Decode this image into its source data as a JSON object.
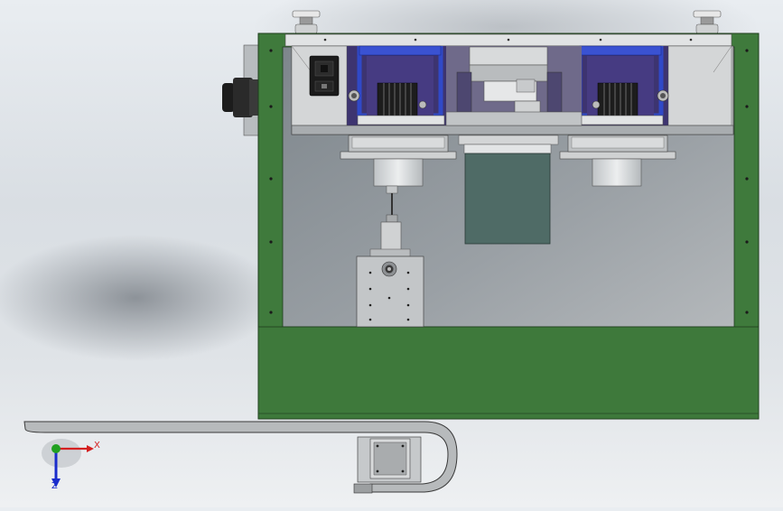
{
  "scene": {
    "view": "front",
    "colors": {
      "frame_green": "#3f7a3c",
      "frame_edge": "#1f3d1d",
      "interior_gray": "#8d949a",
      "panel_light": "#c9ccce",
      "motor_blue": "#2d3fa8",
      "purple_fill": "#4a3c86",
      "dark_panel": "#4f6b66",
      "metal_light": "#d6d8d9",
      "shadow": "#5f656b"
    }
  },
  "triad": {
    "x_label": "X",
    "z_label": "Z",
    "x_color": "#d42020",
    "y_color": "#20a020",
    "z_color": "#1a2ccc"
  }
}
